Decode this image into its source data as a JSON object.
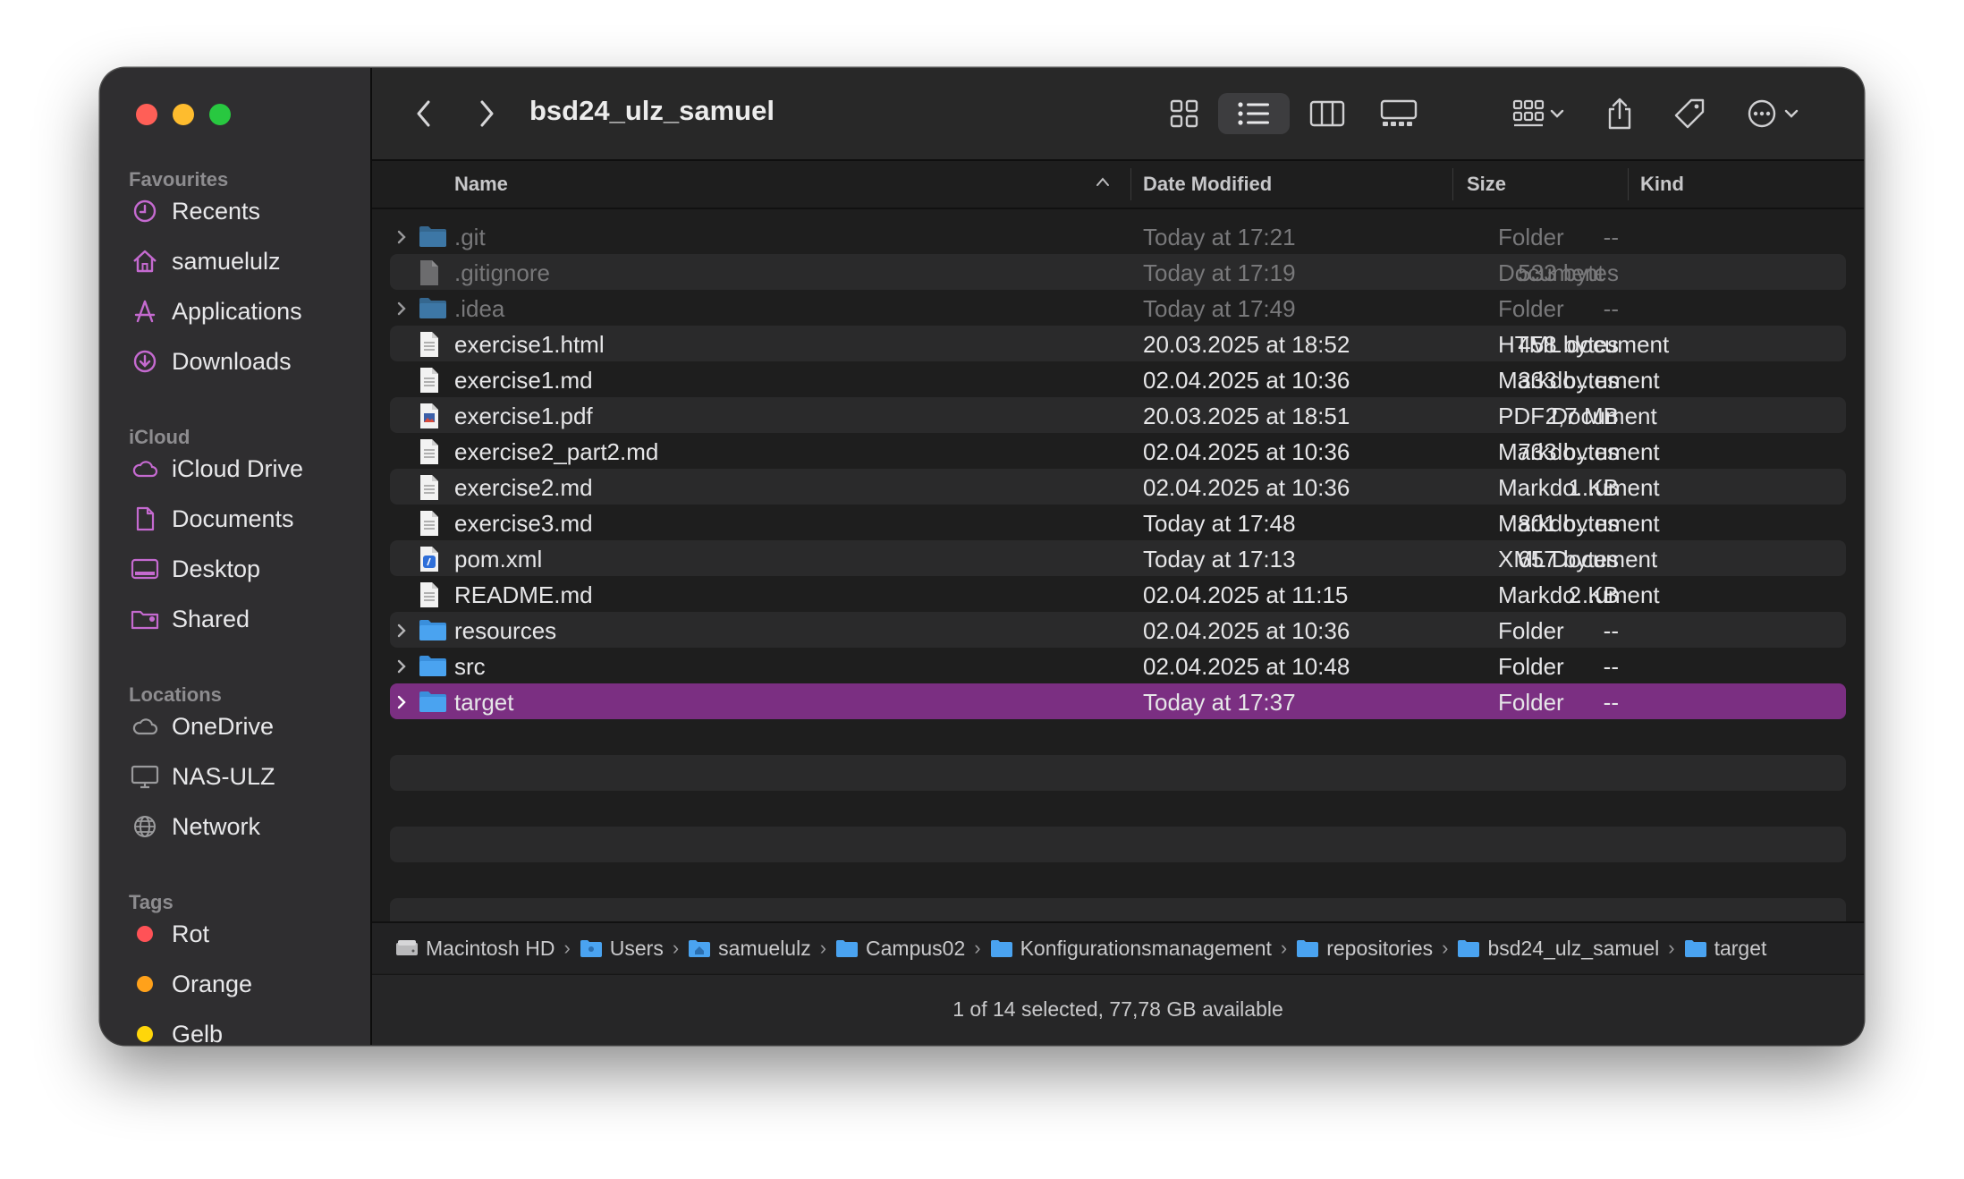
{
  "window": {
    "title": "bsd24_ulz_samuel"
  },
  "sidebar": {
    "favourites_label": "Favourites",
    "favourites": [
      {
        "label": "Recents",
        "icon": "clock-icon"
      },
      {
        "label": "samuelulz",
        "icon": "home-icon"
      },
      {
        "label": "Applications",
        "icon": "applications-icon"
      },
      {
        "label": "Downloads",
        "icon": "download-icon"
      }
    ],
    "icloud_label": "iCloud",
    "icloud": [
      {
        "label": "iCloud Drive",
        "icon": "cloud-icon"
      },
      {
        "label": "Documents",
        "icon": "document-icon"
      },
      {
        "label": "Desktop",
        "icon": "desktop-icon"
      },
      {
        "label": "Shared",
        "icon": "shared-folder-icon"
      }
    ],
    "locations_label": "Locations",
    "locations": [
      {
        "label": "OneDrive",
        "icon": "cloud-icon"
      },
      {
        "label": "NAS-ULZ",
        "icon": "monitor-icon"
      },
      {
        "label": "Network",
        "icon": "globe-icon"
      }
    ],
    "tags_label": "Tags",
    "tags": [
      {
        "label": "Rot",
        "color": "#ff5257"
      },
      {
        "label": "Orange",
        "color": "#ffa11a"
      },
      {
        "label": "Gelb",
        "color": "#ffd60a"
      }
    ]
  },
  "columns": {
    "name": "Name",
    "date": "Date Modified",
    "size": "Size",
    "kind": "Kind"
  },
  "files": [
    {
      "name": ".git",
      "date": "Today at 17:21",
      "size": "--",
      "kind": "Folder",
      "type": "folder",
      "hidden": true
    },
    {
      "name": ".gitignore",
      "date": "Today at 17:19",
      "size": "533 bytes",
      "kind": "Document",
      "type": "doc",
      "hidden": true
    },
    {
      "name": ".idea",
      "date": "Today at 17:49",
      "size": "--",
      "kind": "Folder",
      "type": "folder",
      "hidden": true
    },
    {
      "name": "exercise1.html",
      "date": "20.03.2025 at 18:52",
      "size": "458 bytes",
      "kind": "HTML document",
      "type": "doc"
    },
    {
      "name": "exercise1.md",
      "date": "02.04.2025 at 10:36",
      "size": "333 bytes",
      "kind": "Markdo...ument",
      "type": "doc"
    },
    {
      "name": "exercise1.pdf",
      "date": "20.03.2025 at 18:51",
      "size": "2,7 MB",
      "kind": "PDF Document",
      "type": "pdf"
    },
    {
      "name": "exercise2_part2.md",
      "date": "02.04.2025 at 10:36",
      "size": "733 bytes",
      "kind": "Markdo...ument",
      "type": "doc"
    },
    {
      "name": "exercise2.md",
      "date": "02.04.2025 at 10:36",
      "size": "1 KB",
      "kind": "Markdo...ument",
      "type": "doc"
    },
    {
      "name": "exercise3.md",
      "date": "Today at 17:48",
      "size": "801 bytes",
      "kind": "Markdo...ument",
      "type": "doc"
    },
    {
      "name": "pom.xml",
      "date": "Today at 17:13",
      "size": "657 bytes",
      "kind": "XML Document",
      "type": "xml"
    },
    {
      "name": "README.md",
      "date": "02.04.2025 at 11:15",
      "size": "2 KB",
      "kind": "Markdo...ument",
      "type": "doc"
    },
    {
      "name": "resources",
      "date": "02.04.2025 at 10:36",
      "size": "--",
      "kind": "Folder",
      "type": "folder"
    },
    {
      "name": "src",
      "date": "02.04.2025 at 10:48",
      "size": "--",
      "kind": "Folder",
      "type": "folder"
    },
    {
      "name": "target",
      "date": "Today at 17:37",
      "size": "--",
      "kind": "Folder",
      "type": "folder",
      "selected": true
    }
  ],
  "pathbar": [
    "Macintosh HD",
    "Users",
    "samuelulz",
    "Campus02",
    "Konfigurationsmanagement",
    "repositories",
    "bsd24_ulz_samuel",
    "target"
  ],
  "status": "1 of 14 selected, 77,78 GB available",
  "colors": {
    "accent": "#7b2f82",
    "sidebar_icon": "#c56ad0",
    "folder": "#4aa3f0"
  }
}
